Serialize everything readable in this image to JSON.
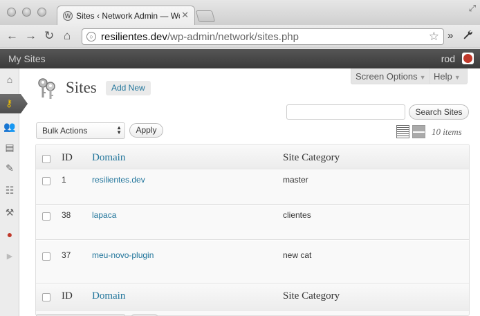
{
  "browser": {
    "tab_title": "Sites ‹ Network Admin — Wo",
    "tab_close": "✕",
    "url_host": "resilientes.dev",
    "url_path": "/wp-admin/network/sites.php",
    "nav_back": "←",
    "nav_forward": "→",
    "nav_reload": "↻",
    "nav_home": "⌂",
    "star": "☆",
    "more": "»",
    "wrench": "🔧",
    "fullscreen": "⤢"
  },
  "adminbar": {
    "my_sites": "My Sites",
    "user": "rod"
  },
  "sidebar": {
    "icons": [
      {
        "name": "dashboard-icon",
        "glyph": "⌂"
      },
      {
        "name": "sites-icon",
        "glyph": "⚷"
      },
      {
        "name": "users-icon",
        "glyph": "👥"
      },
      {
        "name": "themes-icon",
        "glyph": "▤"
      },
      {
        "name": "plugins-icon",
        "glyph": "✎"
      },
      {
        "name": "settings-icon",
        "glyph": "☷"
      },
      {
        "name": "tools-icon",
        "glyph": "⚒"
      },
      {
        "name": "custom-plugin-icon",
        "glyph": "●"
      },
      {
        "name": "collapse-icon",
        "glyph": "▶"
      }
    ]
  },
  "header": {
    "screen_options": "Screen Options",
    "help": "Help",
    "title": "Sites",
    "add_new": "Add New"
  },
  "controls": {
    "search_value": "",
    "search_button": "Search Sites",
    "bulk_actions": "Bulk Actions",
    "apply": "Apply",
    "items_count": "10 items"
  },
  "table": {
    "columns": [
      "ID",
      "Domain",
      "Site Category"
    ],
    "rows": [
      {
        "id": "1",
        "domain": "resilientes.dev",
        "category": "master"
      },
      {
        "id": "38",
        "domain": "lapaca",
        "category": "clientes"
      },
      {
        "id": "37",
        "domain": "meu-novo-plugin",
        "category": "new cat"
      }
    ]
  },
  "colors": {
    "link": "#21759b",
    "adminbar": "#464646",
    "active_icon": "#f2c100",
    "ui_gray": "#ececec"
  }
}
